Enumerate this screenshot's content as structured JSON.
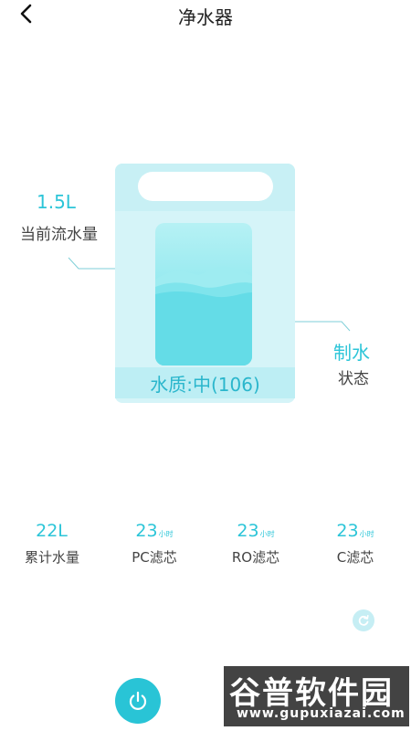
{
  "header": {
    "title": "净水器",
    "back_icon": "chevron-left-icon"
  },
  "device": {
    "water_quality": "水质:中(106)",
    "current_flow_value": "1.5L",
    "current_flow_label": "当前流水量",
    "status_value": "制水",
    "status_label": "状态",
    "colors": {
      "accent": "#2cc5d8",
      "panel": "#d5f4f8",
      "water": "#6adfe9"
    }
  },
  "stats": [
    {
      "value": "22L",
      "unit": "",
      "label": "累计水量"
    },
    {
      "value": "23",
      "unit": "小时",
      "label": "PC滤芯"
    },
    {
      "value": "23",
      "unit": "小时",
      "label": "RO滤芯"
    },
    {
      "value": "23",
      "unit": "小时",
      "label": "C滤芯"
    }
  ],
  "controls": {
    "refresh_icon": "refresh-icon",
    "power_icon": "power-icon"
  },
  "watermark": {
    "big": "谷普软件园",
    "small": "www.gupuxiazai.com"
  }
}
